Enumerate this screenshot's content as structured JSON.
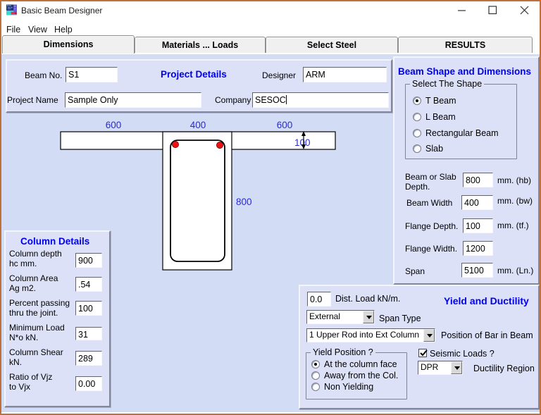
{
  "window": {
    "title": "Basic Beam Designer"
  },
  "menu": {
    "items": [
      {
        "label": "File"
      },
      {
        "label": "View"
      },
      {
        "label": "Help"
      }
    ]
  },
  "tabs": [
    {
      "label": "Dimensions",
      "active": true
    },
    {
      "label": "Materials ... Loads",
      "active": false
    },
    {
      "label": "Select Steel",
      "active": false
    },
    {
      "label": "RESULTS",
      "active": false
    }
  ],
  "project": {
    "title": "Project Details",
    "beam_no_label": "Beam No.",
    "beam_no_value": "S1",
    "designer_label": "Designer",
    "designer_value": "ARM",
    "project_name_label": "Project Name",
    "project_name_value": "Sample Only",
    "company_label": "Company",
    "company_value": "SESOC"
  },
  "drawing": {
    "dim_top_left": "600",
    "dim_top_mid": "400",
    "dim_top_right": "600",
    "dim_flange_thickness": "100",
    "dim_web_depth": "800"
  },
  "column_details": {
    "title": "Column Details",
    "rows": [
      {
        "label": "Column depth hc mm.",
        "value": "900"
      },
      {
        "label": "Column Area Ag m2.",
        "value": ".54"
      },
      {
        "label": "Percent passing thru the joint.",
        "value": "100"
      },
      {
        "label": "Minimum Load N*o kN.",
        "value": "31"
      },
      {
        "label": "Column Shear kN.",
        "value": "289"
      },
      {
        "label": "Ratio of Vjz to Vjx",
        "value": "0.00"
      }
    ]
  },
  "beam_shape": {
    "title": "Beam Shape and Dimensions",
    "group_label": "Select The Shape",
    "shapes": [
      {
        "label": "T Beam",
        "selected": true
      },
      {
        "label": "L Beam",
        "selected": false
      },
      {
        "label": "Rectangular Beam",
        "selected": false
      },
      {
        "label": "Slab",
        "selected": false
      }
    ],
    "fields": [
      {
        "label": "Beam or Slab Depth.",
        "value": "800",
        "unit": "mm. (hb)"
      },
      {
        "label": "Beam Width",
        "value": "400",
        "unit": "mm. (bw)"
      },
      {
        "label": "Flange Depth.",
        "value": "100",
        "unit": "mm. (tf.)"
      },
      {
        "label": "Flange Width.",
        "value": "1200",
        "unit": ""
      },
      {
        "label": "Span",
        "value": "5100",
        "unit": "mm. (Ln.)"
      }
    ]
  },
  "yield": {
    "title": "Yield and Ductility",
    "dist_load_value": "0.0",
    "dist_load_label": "Dist. Load kN/m.",
    "span_type_value": "External",
    "span_type_label": "Span Type",
    "bar_position_value": "1 Upper Rod into Ext Column",
    "bar_position_label": "Position of Bar in Beam",
    "yield_group_label": "Yield Position ?",
    "yield_options": [
      {
        "label": "At the column face",
        "selected": true
      },
      {
        "label": "Away from the Col.",
        "selected": false
      },
      {
        "label": "Non Yielding",
        "selected": false
      }
    ],
    "seismic_label": "Seismic Loads ?",
    "seismic_checked": true,
    "ductility_value": "DPR",
    "ductility_label": "Ductility Region"
  },
  "colors": {
    "window_border": "#c0703a",
    "form_background": "#d3dcf5",
    "panel_background": "#dce1f7",
    "accent_blue": "#0000ee",
    "dimension_blue": "#2a2ad2",
    "rebar_red": "#ee1111"
  }
}
